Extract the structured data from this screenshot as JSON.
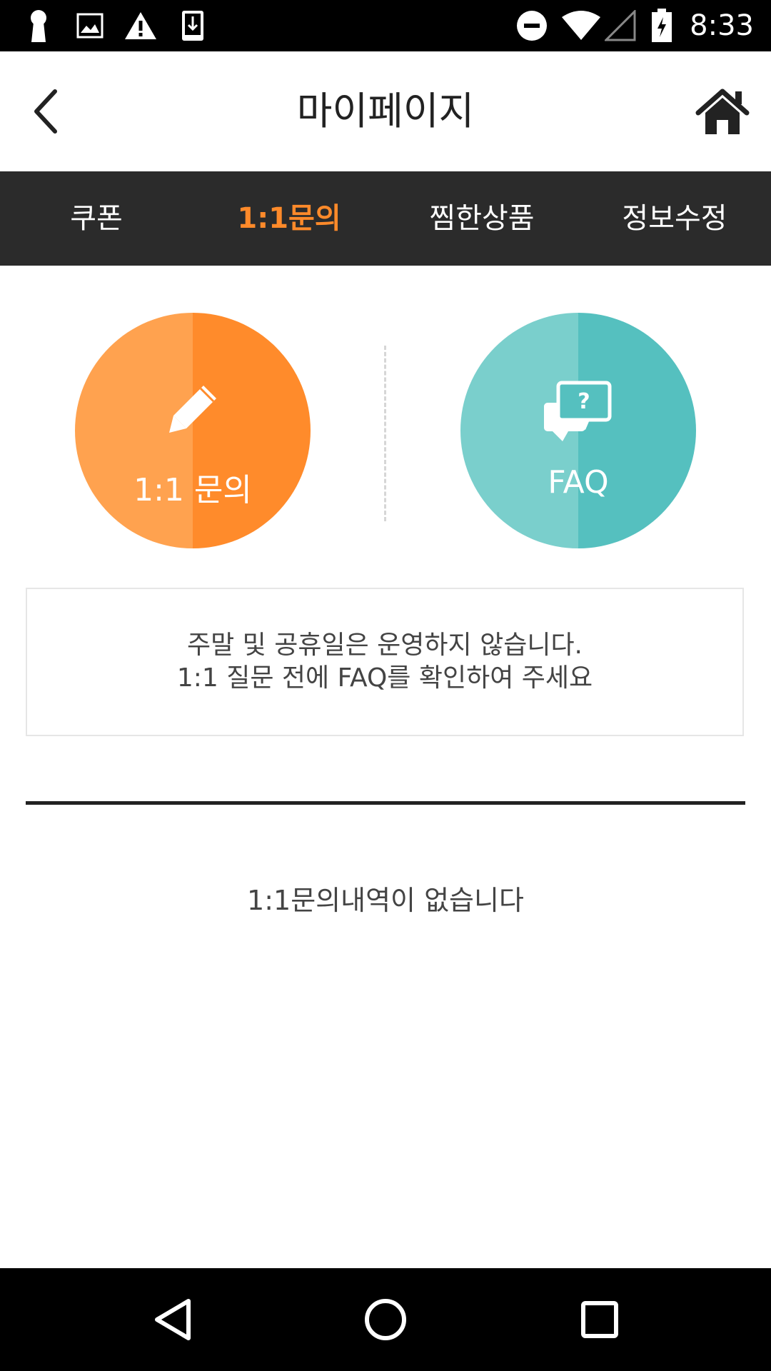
{
  "status_bar": {
    "time": "8:33",
    "icons": [
      "keyhole-icon",
      "image-icon",
      "warning-icon",
      "download-icon",
      "do-not-disturb-icon",
      "wifi-icon",
      "signal-icon",
      "battery-charging-icon"
    ]
  },
  "header": {
    "title": "마이페이지",
    "back_icon": "chevron-left-icon",
    "home_icon": "home-icon"
  },
  "tabs": [
    {
      "label": "쿠폰",
      "active": false
    },
    {
      "label": "1:1문의",
      "active": true
    },
    {
      "label": "찜한상품",
      "active": false
    },
    {
      "label": "정보수정",
      "active": false
    }
  ],
  "actions": {
    "inquiry": {
      "label": "1:1 문의",
      "icon": "pencil-icon",
      "color_left": "#ffa24f",
      "color_right": "#ff8b2b"
    },
    "faq": {
      "label": "FAQ",
      "icon": "chat-question-icon",
      "color_left": "#7acfcc",
      "color_right": "#55c0bf"
    }
  },
  "notice": {
    "line1": "주말 및 공휴일은 운영하지 않습니다.",
    "line2": "1:1 질문 전에 FAQ를 확인하여 주세요"
  },
  "empty_message": "1:1문의내역이 없습니다",
  "nav": {
    "back_icon": "nav-back-icon",
    "home_icon": "nav-home-icon",
    "recents_icon": "nav-recents-icon"
  },
  "colors": {
    "accent": "#ff8a2a",
    "tab_bar": "#2b2b2b"
  }
}
